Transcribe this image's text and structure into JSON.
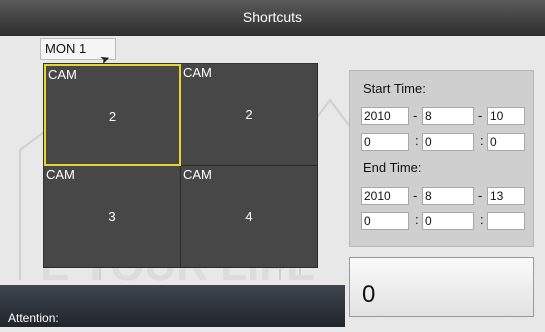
{
  "window": {
    "title": "Shortcuts"
  },
  "monitor_tab": {
    "label": "MON 1"
  },
  "cameras": [
    {
      "label": "CAM",
      "number": "2",
      "selected": true
    },
    {
      "label": "CAM",
      "number": "2",
      "selected": false
    },
    {
      "label": "CAM",
      "number": "3",
      "selected": false
    },
    {
      "label": "CAM",
      "number": "4",
      "selected": false
    }
  ],
  "start_time": {
    "label": "Start Time:",
    "year": "2010",
    "month": "8",
    "day": "10",
    "hour": "0",
    "minute": "0",
    "second": "0"
  },
  "end_time": {
    "label": "End Time:",
    "year": "2010",
    "month": "8",
    "day": "13",
    "hour": "0",
    "minute": "0",
    "second": ""
  },
  "separators": {
    "date": "-",
    "time": ":"
  },
  "counter": {
    "value": "0"
  },
  "attention": {
    "label": "Attention:"
  },
  "colors": {
    "selection": "#e6d531",
    "title_bar": "#3a3a3a"
  }
}
